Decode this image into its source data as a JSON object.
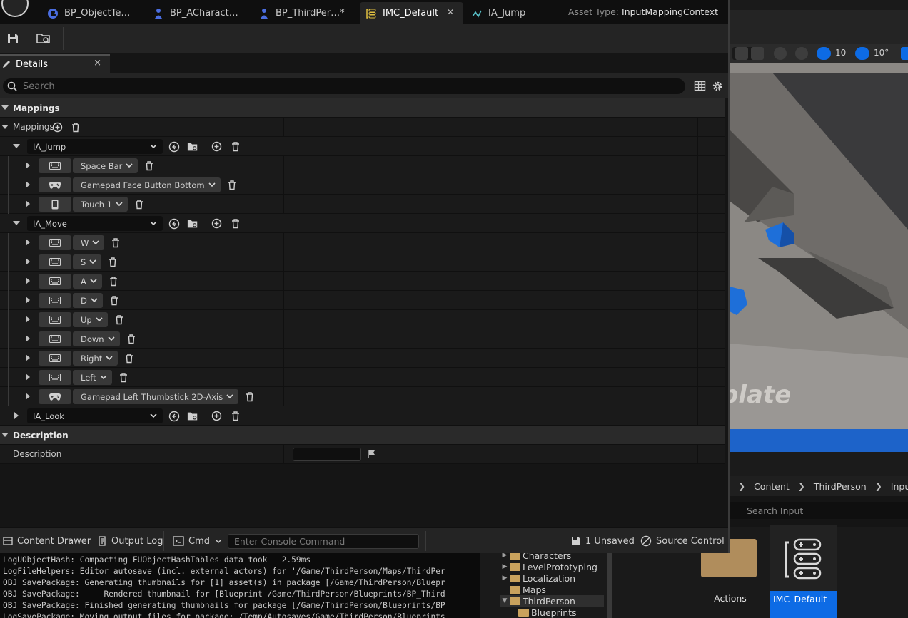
{
  "tabs": [
    {
      "label": "BP_ObjectTe…",
      "icon": "blueprint-icon"
    },
    {
      "label": "BP_ACharact…",
      "icon": "blueprint-icon"
    },
    {
      "label": "BP_ThirdPer…*",
      "icon": "blueprint-icon"
    },
    {
      "label": "IMC_Default",
      "icon": "input-mapping-icon",
      "active": true
    },
    {
      "label": "IA_Jump",
      "icon": "input-action-icon"
    }
  ],
  "asset_type": {
    "label": "Asset Type:",
    "value": "InputMappingContext"
  },
  "details": {
    "tab_label": "Details",
    "close": "×",
    "search_placeholder": "Search",
    "cat_mappings": "Mappings",
    "mappings_label": "Mappings",
    "actions": [
      {
        "name": "IA_Jump",
        "keys": [
          {
            "device": "keyboard",
            "key": "Space Bar"
          },
          {
            "device": "gamepad",
            "key": "Gamepad Face Button Bottom"
          },
          {
            "device": "touch",
            "key": "Touch 1"
          }
        ]
      },
      {
        "name": "IA_Move",
        "keys": [
          {
            "device": "keyboard",
            "key": "W"
          },
          {
            "device": "keyboard",
            "key": "S"
          },
          {
            "device": "keyboard",
            "key": "A"
          },
          {
            "device": "keyboard",
            "key": "D"
          },
          {
            "device": "keyboard",
            "key": "Up"
          },
          {
            "device": "keyboard",
            "key": "Down"
          },
          {
            "device": "keyboard",
            "key": "Right"
          },
          {
            "device": "keyboard",
            "key": "Left"
          },
          {
            "device": "gamepad",
            "key": "Gamepad Left Thumbstick 2D-Axis"
          }
        ]
      },
      {
        "name": "IA_Look",
        "keys": []
      }
    ],
    "cat_description": "Description",
    "description_label": "Description"
  },
  "statusbar": {
    "content_drawer": "Content Drawer",
    "output_log": "Output Log",
    "cmd": "Cmd",
    "console_placeholder": "Enter Console Command",
    "unsaved": "1 Unsaved",
    "source_control": "Source Control"
  },
  "console_lines": [
    "LogUObjectHash: Compacting FUObjectHashTables data took   2.59ms",
    "LogFileHelpers: Editor autosave (incl. external actors) for '/Game/ThirdPerson/Maps/ThirdPer",
    "OBJ SavePackage: Generating thumbnails for [1] asset(s) in package [/Game/ThirdPerson/Bluepr",
    "OBJ SavePackage:     Rendered thumbnail for [Blueprint /Game/ThirdPerson/Blueprints/BP_Third",
    "OBJ SavePackage: Finished generating thumbnails for package [/Game/ThirdPerson/Blueprints/BP",
    "LogSavePackage: Moving output files for package: /Temp/Autosaves/Game/ThirdPerson/Blueprints"
  ],
  "viewport": {
    "grid_value": "10",
    "angle_value": "10°",
    "overlay_text": "plate"
  },
  "breadcrumb": [
    "Content",
    "ThirdPerson",
    "Input"
  ],
  "cb_search_placeholder": "Search Input",
  "folder_tree": [
    {
      "label": "Characters",
      "arrow": "▶",
      "indent": 0
    },
    {
      "label": "LevelPrototyping",
      "arrow": "▶",
      "indent": 0
    },
    {
      "label": "Localization",
      "arrow": "▶",
      "indent": 0
    },
    {
      "label": "Maps",
      "arrow": "",
      "indent": 0
    },
    {
      "label": "ThirdPerson",
      "arrow": "▼",
      "indent": 0,
      "open": true
    },
    {
      "label": "Blueprints",
      "arrow": "",
      "indent": 1
    }
  ],
  "assets": [
    {
      "label": "Actions"
    },
    {
      "label": "IMC_Default",
      "selected": true
    }
  ],
  "colors": {
    "accent": "#0d6be5",
    "panel": "#242424",
    "row": "#1a1a1a",
    "category": "#2a2a2a"
  }
}
